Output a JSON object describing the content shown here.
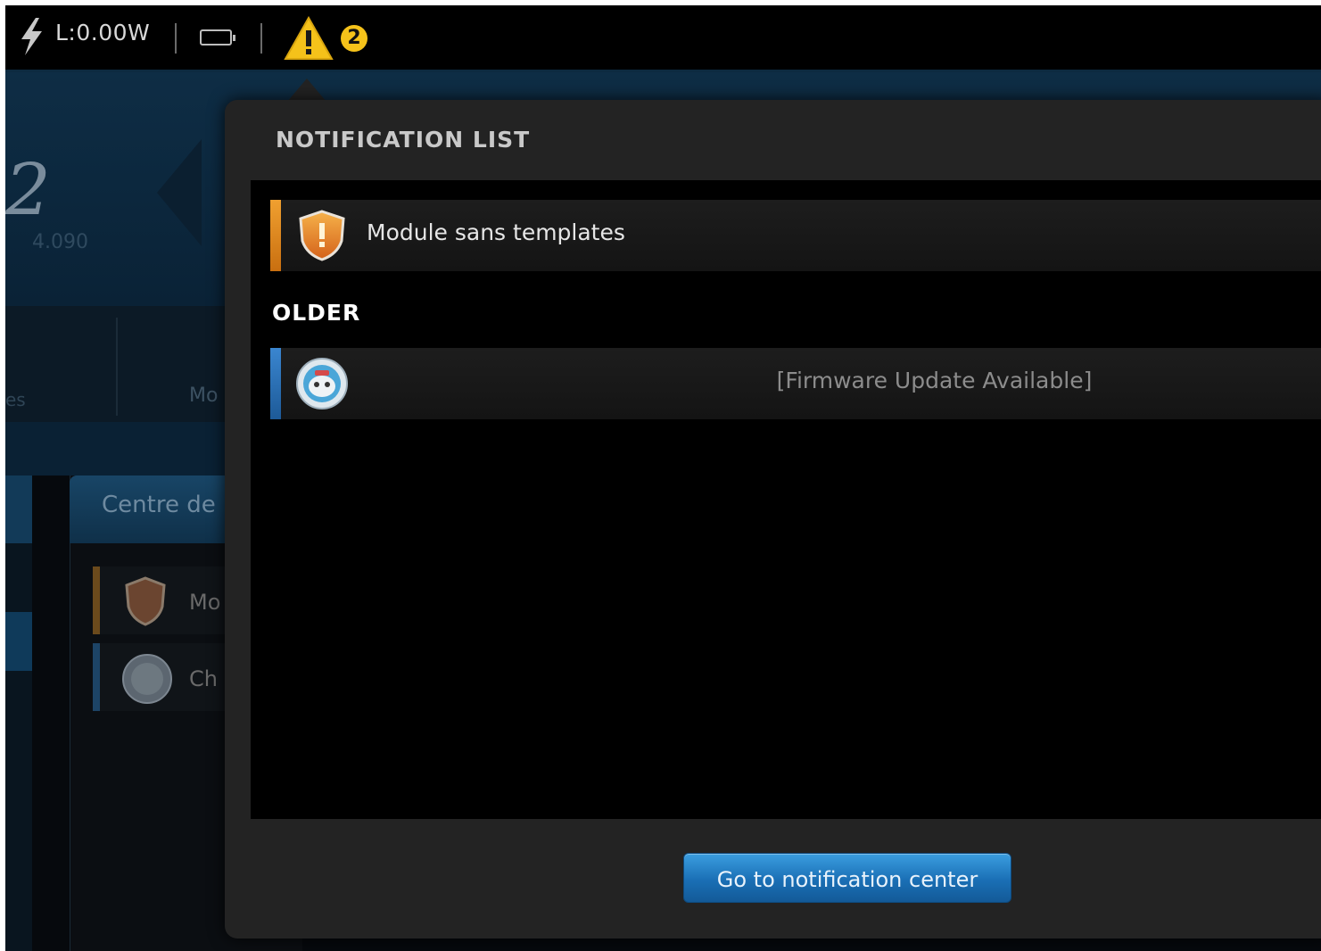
{
  "status_bar": {
    "power_label": "L:0.00W",
    "warning_count": "2"
  },
  "background_app": {
    "logo_text": "2",
    "logo_sub": "4.090",
    "tab_1_partial": "es",
    "tab_2_partial": "Mo",
    "panel_title_partial": "Centre de",
    "items": [
      {
        "text_partial": "Mo"
      },
      {
        "text_partial": "Ch"
      }
    ]
  },
  "popup": {
    "title": "NOTIFICATION LIST",
    "notifications": [
      {
        "text": "Module sans templates",
        "bar_color": "#e08a1e",
        "icon": "shield-warning-icon"
      }
    ],
    "older_label": "OLDER",
    "older_notifications": [
      {
        "text": "[Firmware Update Available]",
        "bar_color": "#2a6db0",
        "icon": "robot-face-icon"
      }
    ],
    "button_label": "Go to notification center"
  },
  "colors": {
    "accent_blue": "#1a6fb5",
    "warning_yellow": "#f5c21a",
    "warning_orange": "#e08a1e"
  }
}
